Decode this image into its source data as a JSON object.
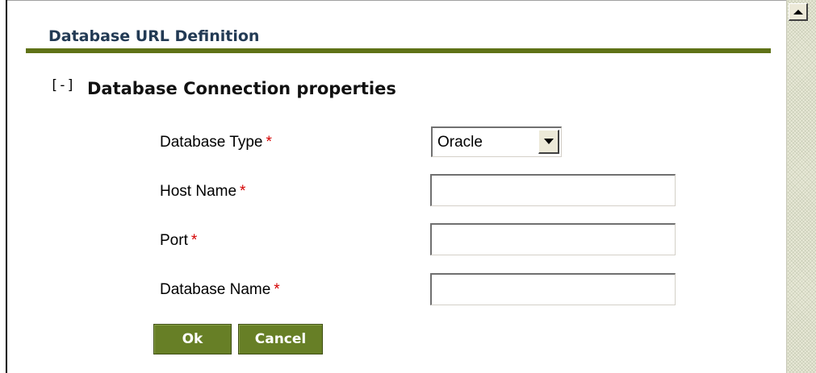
{
  "header": {
    "title": "Database URL Definition"
  },
  "section": {
    "toggle_label": "[-]",
    "title": "Database Connection properties"
  },
  "form": {
    "required_marker": "*",
    "database_type": {
      "label": "Database Type",
      "selected": "Oracle"
    },
    "host_name": {
      "label": "Host Name",
      "value": ""
    },
    "port": {
      "label": "Port",
      "value": ""
    },
    "database_name": {
      "label": "Database Name",
      "value": ""
    }
  },
  "buttons": {
    "ok_label": "Ok",
    "cancel_label": "Cancel"
  },
  "colors": {
    "accent": "#5f7217",
    "button_bg": "#677f26",
    "title_text": "#223a54",
    "required": "#d40000"
  },
  "icons": {
    "scroll_up": "triangle-up-icon",
    "dropdown": "chevron-down-icon"
  }
}
